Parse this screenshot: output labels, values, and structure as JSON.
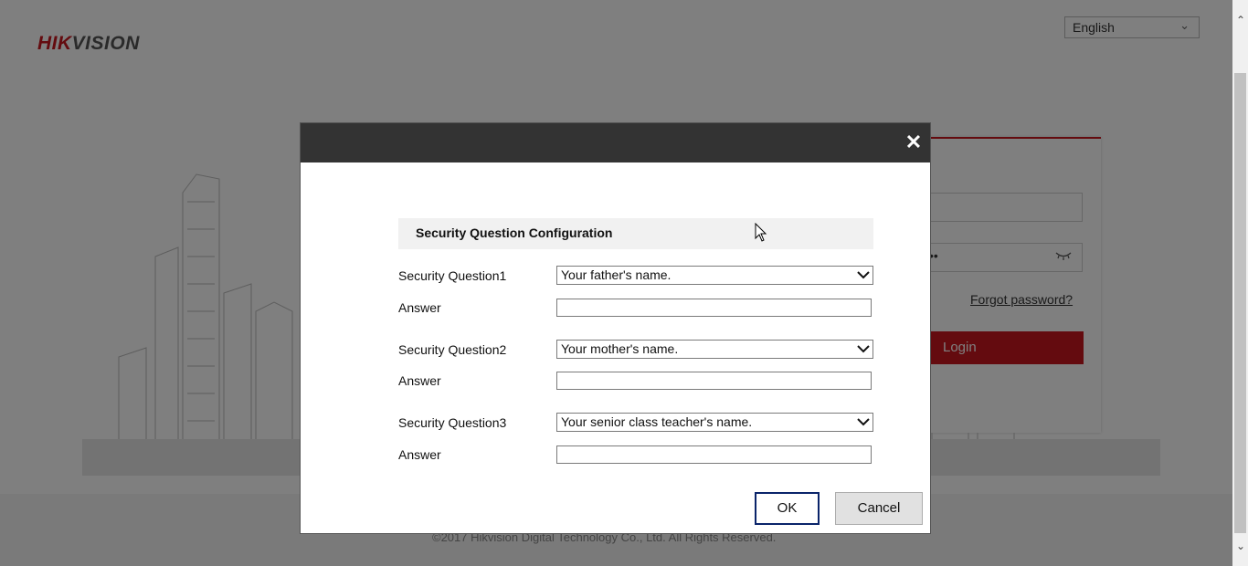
{
  "brand": {
    "logo_red": "HIK",
    "logo_gray": "VISION"
  },
  "language": {
    "selected": "English"
  },
  "login": {
    "password_mask": "••",
    "forgot_label": "Forgot password?",
    "login_label": "Login"
  },
  "footer": {
    "copyright": "©2017 Hikvision Digital Technology Co., Ltd. All Rights Reserved."
  },
  "dialog": {
    "close_symbol": "✕",
    "section_title": "Security Question Configuration",
    "questions": [
      {
        "label": "Security Question1",
        "selected": "Your father's name.",
        "answer_label": "Answer",
        "answer_value": ""
      },
      {
        "label": "Security Question2",
        "selected": "Your mother's name.",
        "answer_label": "Answer",
        "answer_value": ""
      },
      {
        "label": "Security Question3",
        "selected": "Your senior class teacher's name.",
        "answer_label": "Answer",
        "answer_value": ""
      }
    ],
    "ok_label": "OK",
    "cancel_label": "Cancel"
  },
  "colors": {
    "brand_red": "#c8171e",
    "header_dark": "#333333"
  },
  "icons": [
    "close-icon",
    "dropdown-arrow-icon",
    "eye-icon",
    "chevron-down-icon",
    "mouse-cursor-icon"
  ]
}
